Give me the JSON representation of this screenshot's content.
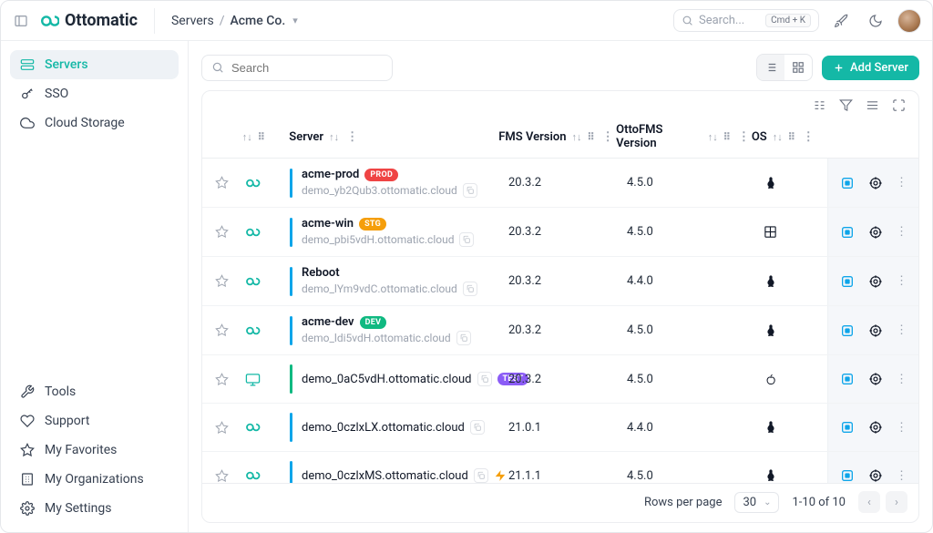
{
  "brand": {
    "name": "Ottomatic"
  },
  "breadcrumb": {
    "root": "Servers",
    "sep": "/",
    "current": "Acme Co."
  },
  "topbar": {
    "search_placeholder": "Search...",
    "kbd": "Cmd + K"
  },
  "sidebar": {
    "primary": [
      {
        "label": "Servers",
        "icon": "servers",
        "active": true
      },
      {
        "label": "SSO",
        "icon": "key",
        "active": false
      },
      {
        "label": "Cloud Storage",
        "icon": "cloud",
        "active": false
      }
    ],
    "secondary": [
      {
        "label": "Tools",
        "icon": "tools"
      },
      {
        "label": "Support",
        "icon": "heart"
      },
      {
        "label": "My Favorites",
        "icon": "star"
      },
      {
        "label": "My Organizations",
        "icon": "org"
      },
      {
        "label": "My Settings",
        "icon": "gear"
      }
    ]
  },
  "toolbar": {
    "search_placeholder": "Search",
    "add_label": "Add Server"
  },
  "table": {
    "headers": {
      "server": "Server",
      "fms": "FMS Version",
      "otto": "OttoFMS Version",
      "os": "OS"
    },
    "rows": [
      {
        "name": "acme-prod",
        "badge": "PROD",
        "badge_color": "#ef4444",
        "host": "demo_yb2Qub3.ottomatic.cloud",
        "stripe": "#0ea5e9",
        "fms": "20.3.2",
        "otto": "4.5.0",
        "os": "linux",
        "icon": "link",
        "copy": true,
        "sub": true
      },
      {
        "name": "acme-win",
        "badge": "STG",
        "badge_color": "#f59e0b",
        "host": "demo_pbi5vdH.ottomatic.cloud",
        "stripe": "#0ea5e9",
        "fms": "20.3.2",
        "otto": "4.5.0",
        "os": "windows",
        "icon": "link",
        "copy": true,
        "sub": true
      },
      {
        "name": "Reboot",
        "badge": "",
        "badge_color": "",
        "host": "demo_lYm9vdC.ottomatic.cloud",
        "stripe": "#0ea5e9",
        "fms": "20.3.2",
        "otto": "4.4.0",
        "os": "linux",
        "icon": "link",
        "copy": true,
        "sub": true
      },
      {
        "name": "acme-dev",
        "badge": "DEV",
        "badge_color": "#10b981",
        "host": "demo_ldi5vdH.ottomatic.cloud",
        "stripe": "#0ea5e9",
        "fms": "20.3.2",
        "otto": "4.5.0",
        "os": "linux",
        "icon": "link",
        "copy": true,
        "sub": true
      },
      {
        "name": "demo_0aC5vdH.ottomatic.cloud",
        "badge": "TEST",
        "badge_color": "#8b5cf6",
        "host": "",
        "stripe": "#10b981",
        "fms": "20.3.2",
        "otto": "4.5.0",
        "os": "apple",
        "icon": "monitor",
        "copy": true,
        "sub": false
      },
      {
        "name": "demo_0czlxLX.ottomatic.cloud",
        "badge": "",
        "badge_color": "",
        "host": "",
        "stripe": "#0ea5e9",
        "fms": "21.0.1",
        "otto": "4.4.0",
        "os": "linux",
        "icon": "link",
        "copy": true,
        "sub": false
      },
      {
        "name": "demo_0czlxMS.ottomatic.cloud",
        "badge": "",
        "badge_color": "",
        "host": "",
        "stripe": "#0ea5e9",
        "fms": "21.1.1",
        "otto": "4.5.0",
        "os": "linux",
        "icon": "link",
        "copy": true,
        "sub": false,
        "lightning": true
      }
    ]
  },
  "footer": {
    "rpp_label": "Rows per page",
    "rpp_value": "30",
    "range": "1-10 of 10"
  },
  "colors": {
    "accent": "#14b8a6"
  }
}
